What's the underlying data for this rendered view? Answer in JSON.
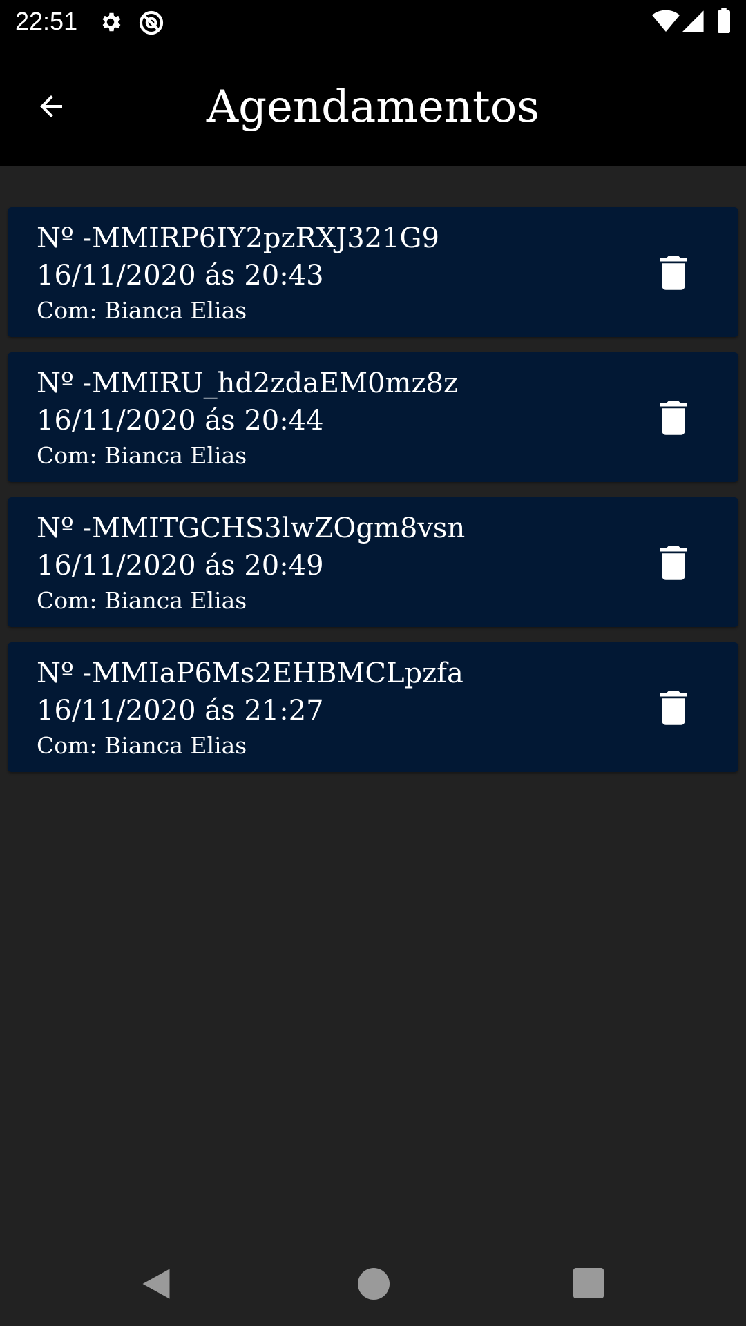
{
  "status_bar": {
    "time": "22:51",
    "icons": [
      "gear-icon",
      "sync-off-icon",
      "wifi-icon",
      "signal-icon",
      "battery-icon"
    ]
  },
  "app_bar": {
    "title": "Agendamentos",
    "back_icon": "arrow-left-icon"
  },
  "appointments": [
    {
      "number": "Nº -MMIRP6IY2pzRXJ321G9",
      "datetime": "16/11/2020 ás 20:43",
      "with": "Com: Bianca Elias"
    },
    {
      "number": "Nº -MMIRU_hd2zdaEM0mz8z",
      "datetime": "16/11/2020 ás 20:44",
      "with": "Com: Bianca Elias"
    },
    {
      "number": "Nº -MMITGCHS3lwZOgm8vsn",
      "datetime": "16/11/2020 ás 20:49",
      "with": "Com: Bianca Elias"
    },
    {
      "number": "Nº -MMIaP6Ms2EHBMCLpzfa",
      "datetime": "16/11/2020 ás 21:27",
      "with": "Com: Bianca Elias"
    }
  ],
  "card_action_icon": "trash-icon",
  "nav_bar": {
    "icons": [
      "back-triangle-icon",
      "home-circle-icon",
      "recents-square-icon"
    ]
  },
  "colors": {
    "app_bar_bg": "#000000",
    "page_bg": "#222222",
    "card_bg": "#021834",
    "text": "#ffffff"
  }
}
